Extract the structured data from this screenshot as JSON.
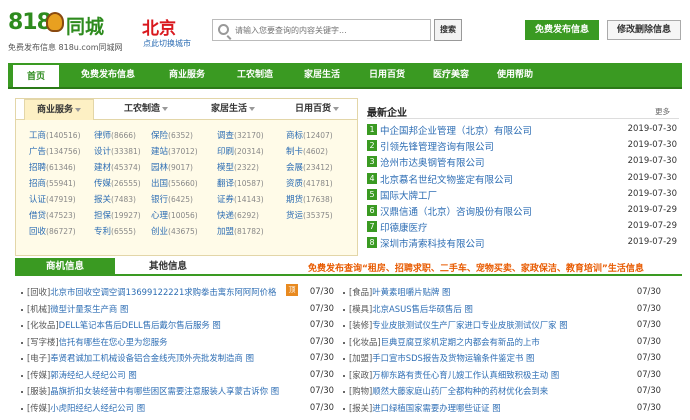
{
  "logo": {
    "big_number": "818",
    "city_name_text": "同城",
    "slogan": "免费发布信息 818u.com同城网"
  },
  "city": {
    "name": "北京",
    "switch": "点此切换城市"
  },
  "search": {
    "placeholder": "请输入您要查询的内容关键字...",
    "button": "搜索"
  },
  "header_buttons": {
    "publish": "免费发布信息",
    "edit": "修改删除信息"
  },
  "nav": [
    "首页",
    "免费发布信息",
    "商业服务",
    "工农制造",
    "家居生活",
    "日用百货",
    "医疗美容",
    "使用帮助"
  ],
  "tabs": [
    "商业服务",
    "工农制造",
    "家居生活",
    "日用百货"
  ],
  "categories": [
    [
      "工商",
      "(140516)"
    ],
    [
      "律师",
      "(8666)"
    ],
    [
      "保险",
      "(6352)"
    ],
    [
      "调查",
      "(32170)"
    ],
    [
      "商标",
      "(12407)"
    ],
    [
      "广告",
      "(134756)"
    ],
    [
      "设计",
      "(33381)"
    ],
    [
      "建站",
      "(37012)"
    ],
    [
      "印刷",
      "(20314)"
    ],
    [
      "制卡",
      "(4602)"
    ],
    [
      "招聘",
      "(61346)"
    ],
    [
      "建材",
      "(45374)"
    ],
    [
      "园林",
      "(9017)"
    ],
    [
      "模型",
      "(2322)"
    ],
    [
      "会展",
      "(23412)"
    ],
    [
      "招商",
      "(55941)"
    ],
    [
      "传媒",
      "(26555)"
    ],
    [
      "出国",
      "(55660)"
    ],
    [
      "翻译",
      "(10587)"
    ],
    [
      "资质",
      "(41781)"
    ],
    [
      "认证",
      "(47919)"
    ],
    [
      "报关",
      "(7483)"
    ],
    [
      "银行",
      "(6425)"
    ],
    [
      "证券",
      "(14143)"
    ],
    [
      "期货",
      "(17638)"
    ],
    [
      "借贷",
      "(47523)"
    ],
    [
      "担保",
      "(19927)"
    ],
    [
      "心理",
      "(10056)"
    ],
    [
      "快递",
      "(6292)"
    ],
    [
      "货运",
      "(35375)"
    ],
    [
      "回收",
      "(86727)"
    ],
    [
      "专利",
      "(6555)"
    ],
    [
      "创业",
      "(43675)"
    ],
    [
      "加盟",
      "(81782)"
    ]
  ],
  "latest": {
    "title": "最新企业",
    "more": "更多",
    "items": [
      {
        "n": "1",
        "name": "中企国邦企业管理（北京）有限公司",
        "date": "2019-07-30"
      },
      {
        "n": "2",
        "name": "引领先锋管理咨询有限公司",
        "date": "2019-07-30"
      },
      {
        "n": "3",
        "name": "沧州市达奥钢管有限公司",
        "date": "2019-07-30"
      },
      {
        "n": "4",
        "name": "北京慕名世纪文物鉴定有限公司",
        "date": "2019-07-30"
      },
      {
        "n": "5",
        "name": "国际大牌工厂",
        "date": "2019-07-30"
      },
      {
        "n": "6",
        "name": "汉鼎信通（北京）咨询股份有限公司",
        "date": "2019-07-29"
      },
      {
        "n": "7",
        "name": "印德康医疗",
        "date": "2019-07-29"
      },
      {
        "n": "8",
        "name": "深圳市清索科技有限公司",
        "date": "2019-07-29"
      }
    ]
  },
  "section": {
    "tab_active": "商机信息",
    "tab_other": "其他信息",
    "promo": "免费发布查询“租房、招聘求职、二手车、宠物买卖、家政保洁、教育培训”生活信息"
  },
  "left_list": [
    {
      "cat": "[回收]",
      "text": "北京市回收空调空调13699122221求购拳击寓东阿阿阿价格",
      "date": "07/30",
      "tag": "顶"
    },
    {
      "cat": "[机械]",
      "text": "微型计量泵生产商 图",
      "date": "07/30"
    },
    {
      "cat": "[化妆品]",
      "text": "DELL笔记本售后DELL售后戴尔售后服务 图",
      "date": "07/30"
    },
    {
      "cat": "[写字楼]",
      "text": "信托有哪些在您心里为您服务",
      "date": "07/30"
    },
    {
      "cat": "[电子]",
      "text": "奉贤君诚加工机械设备铝合金线壳顶外壳批发制造商 图",
      "date": "07/30"
    },
    {
      "cat": "[传媒]",
      "text": "郭涛经纪人经纪公司 图",
      "date": "07/30"
    },
    {
      "cat": "[服装]",
      "text": "晶旗折扣女装经营中有哪些困区需要注意服装人享蒙古诉你 图",
      "date": "07/30"
    },
    {
      "cat": "[传媒]",
      "text": "小虎阳经纪人经纪公司 图",
      "date": "07/30"
    }
  ],
  "right_list": [
    {
      "cat": "[食品]",
      "text": "叶黄素咀嚼片贴牌 图",
      "date": "07/30"
    },
    {
      "cat": "[模具]",
      "text": "北京ASUS售后华硕售后 图",
      "date": "07/30"
    },
    {
      "cat": "[装修]",
      "text": "专业皮肤测试仪生产厂家进口专业皮肤测试仪厂家 图",
      "date": "07/30"
    },
    {
      "cat": "[化妆品]",
      "text": "巨典豆腐豆浆机定期之内都会有新品的上市",
      "date": "07/30"
    },
    {
      "cat": "[加盟]",
      "text": "手口宣市SDS报告及货物运输条件鉴定书 图",
      "date": "07/30"
    },
    {
      "cat": "[家政]",
      "text": "万柳东路有责任心育儿嫂工作认真细致积极主动 图",
      "date": "07/30"
    },
    {
      "cat": "[购物]",
      "text": "顺然大藤家庭山药厂全都构种的药材优化会到来",
      "date": "07/30"
    },
    {
      "cat": "[报关]",
      "text": "进口绿植国家需要办理哪些证证 图",
      "date": "07/30"
    }
  ]
}
